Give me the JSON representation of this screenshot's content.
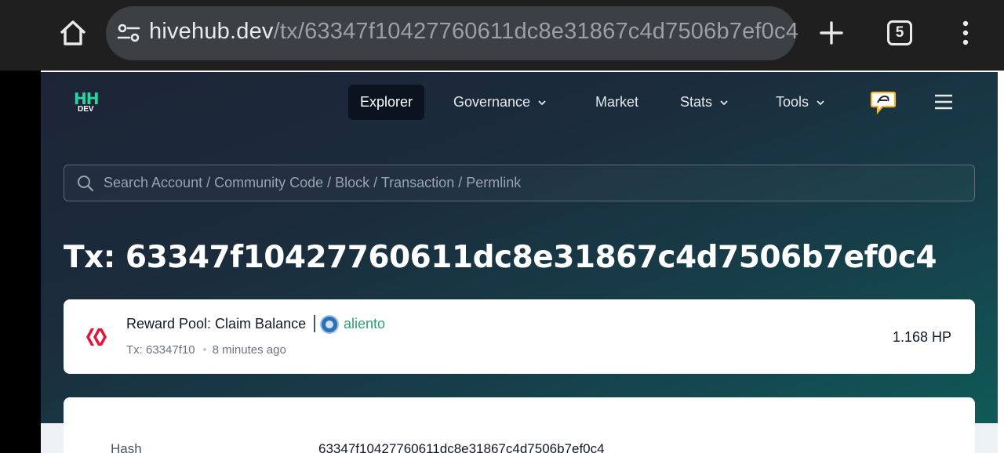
{
  "browser": {
    "url_host": "hivehub.dev",
    "url_path": "/tx/63347f10427760611dc8e31867c4d7506b7ef0c4",
    "tab_count": "5",
    "icons": [
      "home-icon",
      "site-settings-icon",
      "new-tab-plus-icon",
      "tab-switcher-icon",
      "more-vert-icon"
    ]
  },
  "site": {
    "logo_text": "HH",
    "logo_sub": "DEV",
    "nav": {
      "explorer": "Explorer",
      "governance": "Governance",
      "market": "Market",
      "stats": "Stats",
      "tools": "Tools"
    },
    "search_placeholder": "Search Account / Community Code / Block / Transaction / Permlink"
  },
  "tx": {
    "title": "Tx: 63347f10427760611dc8e31867c4d7506b7ef0c4",
    "operation": {
      "name": "Reward Pool: Claim Balance",
      "account": "aliento",
      "tx_short": "Tx: 63347f10",
      "time_ago": "8 minutes ago",
      "amount": "1.168 HP"
    },
    "details": {
      "hash_label": "Hash",
      "hash_value": "63347f10427760611dc8e31867c4d7506b7ef0c4"
    }
  },
  "colors": {
    "accent_green": "#2f9e72",
    "logo_green": "#2ed3a3",
    "hive_red": "#e31337"
  }
}
